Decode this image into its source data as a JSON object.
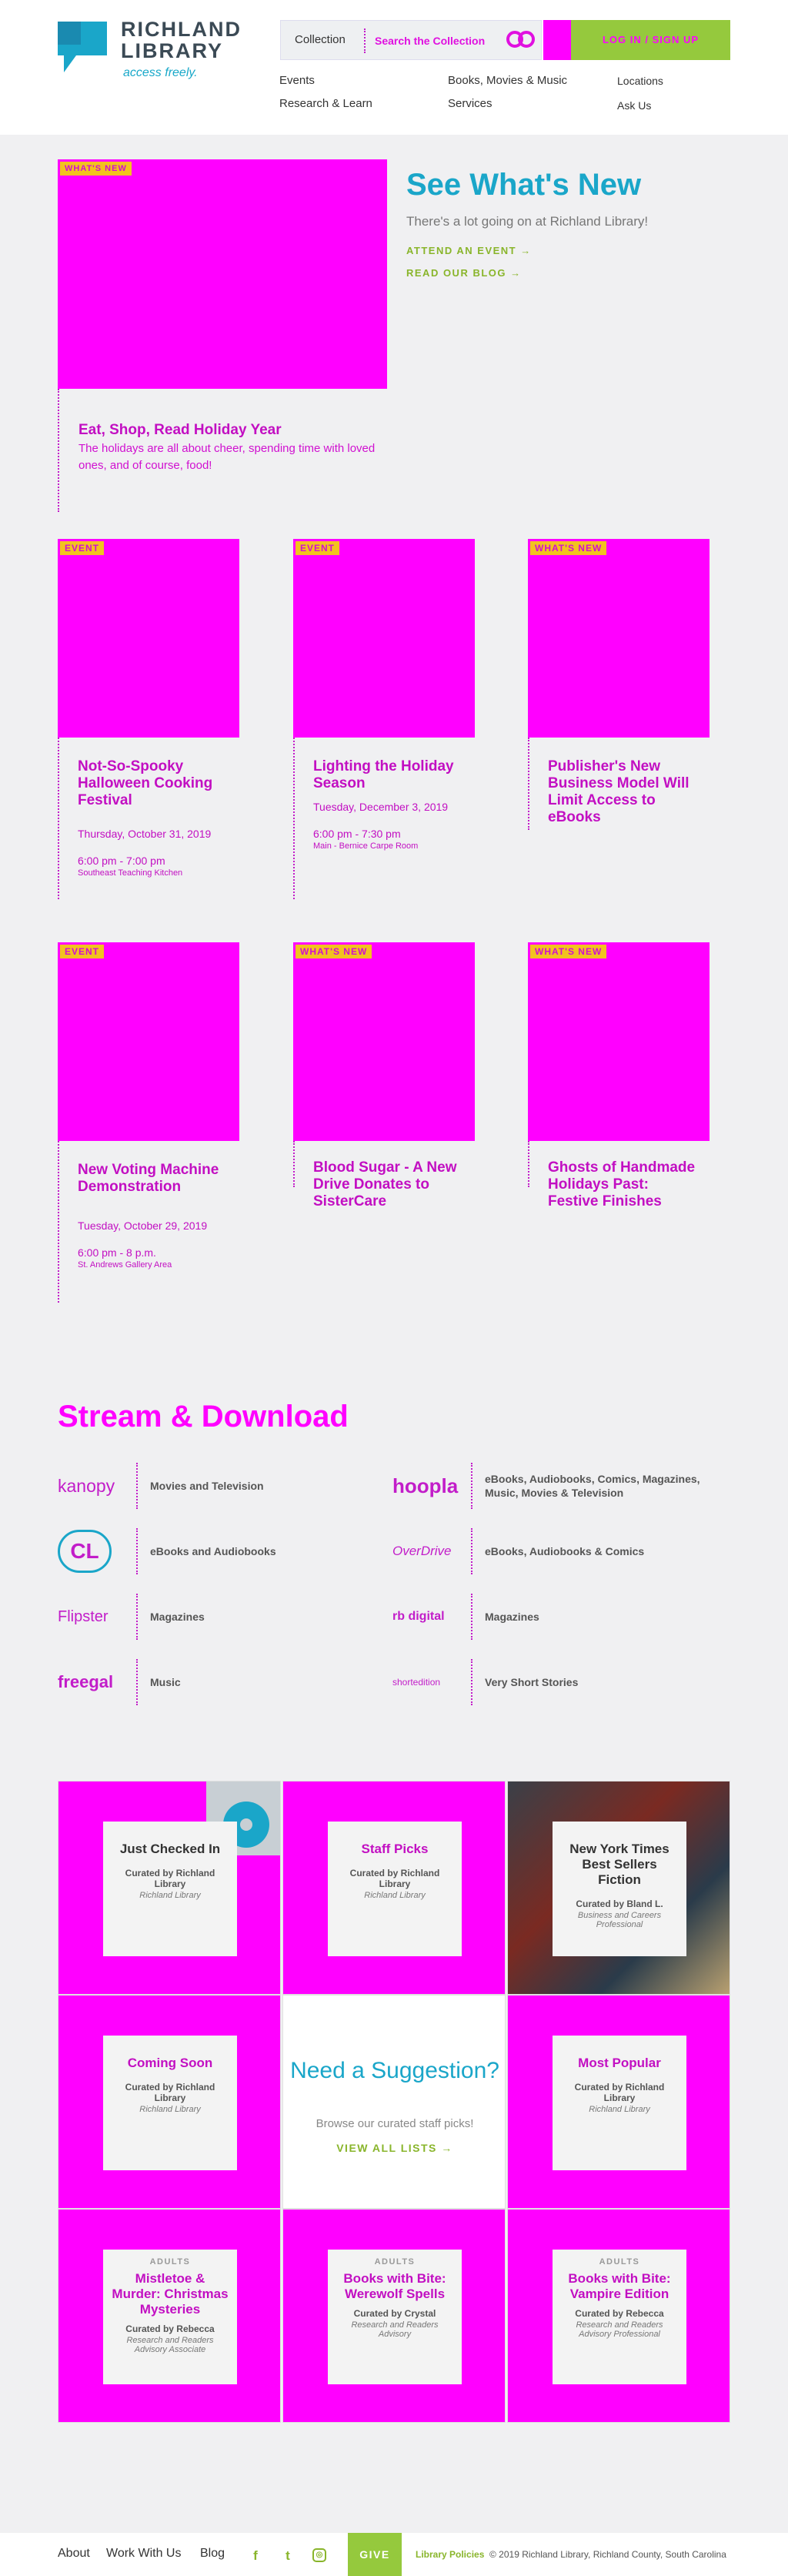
{
  "header": {
    "logo_line1": "RICHLAND",
    "logo_line2": "LIBRARY",
    "tagline": "access freely.",
    "search_scope": "Collection",
    "search_placeholder": "Search the Collection",
    "login_label": "LOG IN / SIGN UP",
    "nav": [
      "Events",
      "Research & Learn",
      "Books, Movies & Music",
      "Services"
    ],
    "nav_small": [
      "Locations",
      "Ask Us"
    ]
  },
  "hero": {
    "tag": "WHAT'S NEW",
    "title": "Eat, Shop, Read Holiday Year",
    "body": "The holidays are all about cheer, spending time with loved ones, and of course, food!"
  },
  "whats_new": {
    "title": "See What's New",
    "subtitle": "There's a lot going on at Richland Library!",
    "link_events": "ATTEND AN EVENT →",
    "link_blog": "READ OUR BLOG →"
  },
  "cards": [
    {
      "tag": "EVENT",
      "title": "Not-So-Spooky Halloween Cooking Festival",
      "date": "Thursday, October 31, 2019",
      "time": "6:00 pm - 7:00 pm",
      "location": "Southeast Teaching Kitchen"
    },
    {
      "tag": "EVENT",
      "title": "Lighting the Holiday Season",
      "date": "Tuesday, December 3, 2019",
      "time": "6:00 pm - 7:30 pm",
      "location": "Main - Bernice Carpe Room"
    },
    {
      "tag": "WHAT'S NEW",
      "title": "Publisher's New Business Model Will Limit Access to eBooks",
      "date": "",
      "time": "",
      "location": ""
    },
    {
      "tag": "EVENT",
      "title": "New Voting Machine Demonstration",
      "date": "Tuesday, October 29, 2019",
      "time": "6:00 pm - 8 p.m.",
      "location": "St. Andrews Gallery Area"
    },
    {
      "tag": "WHAT'S NEW",
      "title": "Blood Sugar - A New Drive Donates to SisterCare",
      "date": "",
      "time": "",
      "location": ""
    },
    {
      "tag": "WHAT'S NEW",
      "title": "Ghosts of Handmade Holidays Past: Festive Finishes",
      "date": "",
      "time": "",
      "location": ""
    }
  ],
  "stream": {
    "title": "Stream & Download",
    "services": [
      {
        "logo": "kanopy",
        "label": "Movies and Television"
      },
      {
        "logo": "hoopla",
        "label": "eBooks, Audiobooks, Comics, Magazines, Music, Movies & Television"
      },
      {
        "logo": "CL",
        "label": "eBooks and Audiobooks"
      },
      {
        "logo": "OverDrive",
        "label": "eBooks, Audiobooks & Comics"
      },
      {
        "logo": "Flipster",
        "label": "Magazines"
      },
      {
        "logo": "rb digital",
        "label": "Magazines"
      },
      {
        "logo": "freegal",
        "label": "Music"
      },
      {
        "logo": "shortedition",
        "label": "Very Short Stories"
      }
    ]
  },
  "lists": [
    {
      "kicker": "",
      "title": "Just Checked In",
      "by": "Curated by Richland Library",
      "role": "Richland Library",
      "mag": false
    },
    {
      "kicker": "",
      "title": "Staff Picks",
      "by": "Curated by Richland Library",
      "role": "Richland Library",
      "mag": true
    },
    {
      "kicker": "",
      "title": "New York Times Best Sellers Fiction",
      "by": "Curated by Bland L.",
      "role": "Business and Careers Professional",
      "mag": false
    },
    {
      "kicker": "",
      "title": "Coming Soon",
      "by": "Curated by Richland Library",
      "role": "Richland Library",
      "mag": true
    },
    {
      "kicker": "",
      "title": "Most Popular",
      "by": "Curated by Richland Library",
      "role": "Richland Library",
      "mag": true
    },
    {
      "kicker": "ADULTS",
      "title": "Mistletoe & Murder: Christmas Mysteries",
      "by": "Curated by Rebecca",
      "role": "Research and Readers Advisory Associate",
      "mag": true
    },
    {
      "kicker": "ADULTS",
      "title": "Books with Bite: Werewolf Spells",
      "by": "Curated by Crystal",
      "role": "Research and Readers Advisory",
      "mag": true
    },
    {
      "kicker": "ADULTS",
      "title": "Books with Bite: Vampire Edition",
      "by": "Curated by Rebecca",
      "role": "Research and Readers Advisory Professional",
      "mag": true
    }
  ],
  "suggestion": {
    "title": "Need a Suggestion?",
    "subtitle": "Browse our curated staff picks!",
    "link": "VIEW ALL LISTS →"
  },
  "footer": {
    "links": [
      "About",
      "Work With Us",
      "Blog"
    ],
    "give": "GIVE",
    "policies": "Library Policies",
    "copyright": "© 2019 Richland Library, Richland County, South Carolina"
  }
}
